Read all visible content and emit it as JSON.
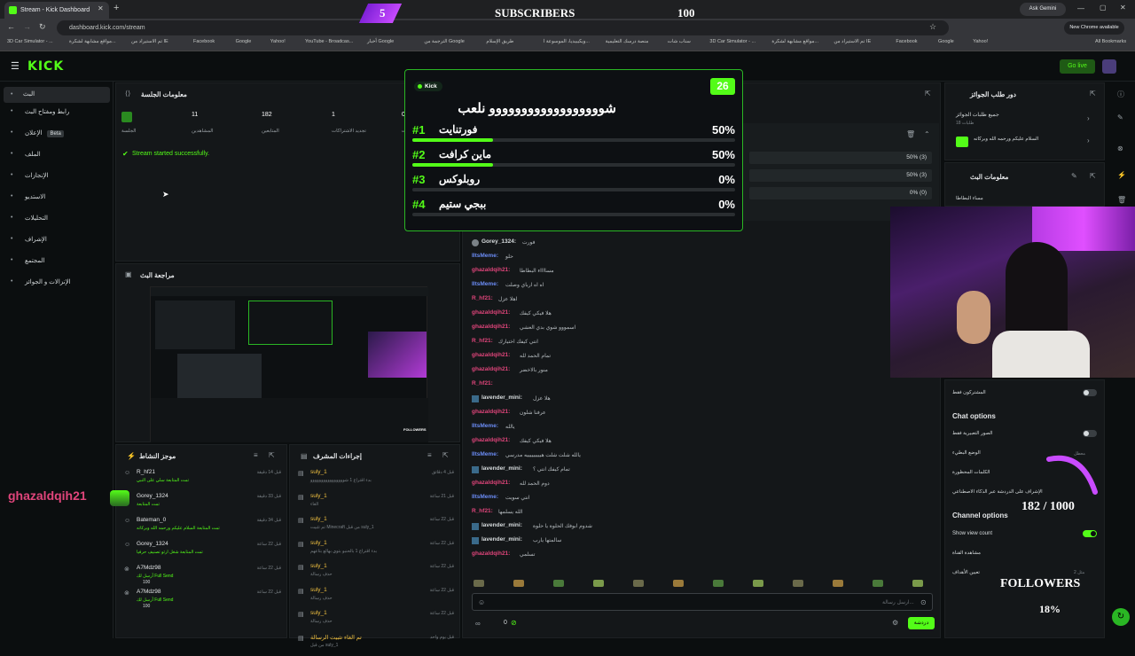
{
  "browser": {
    "tab_title": "Stream - Kick Dashboard",
    "url": "dashboard.kick.com/stream",
    "ask_gemini": "Ask Gemini",
    "new_chrome": "New Chrome available",
    "all_bookmarks": "All Bookmarks",
    "bookmarks": [
      "3D Car Simulator - ...",
      "مواقع مشابهة لشكرة...",
      "تم الاستيراد من IE",
      "Facebook",
      "Google",
      "Yahoo!",
      "YouTube - Broadcas...",
      "أخبار Google",
      "الترجمة من Google",
      "طريق الإسلام",
      "ويكيبيديا، الموسوعة ا...",
      "منصة درسك التعليمية",
      "سناب شات",
      "3D Car Simulator - ...",
      "مواقع مشابهة لشكرة...",
      "تم الاستيراد من IE",
      "Facebook",
      "Google",
      "Yahoo!"
    ]
  },
  "overlay": {
    "sub_count": "5",
    "subscribers_label": "SUBSCRIBERS",
    "sub_goal": "100",
    "followers_count": "182 / 1000",
    "followers_label": "FOLLOWERS",
    "followers_pct": "18%",
    "followers_progress": 0.18,
    "chat_highlight_name": "ghazaldqih21"
  },
  "topnav": {
    "logo": "KICK",
    "go_live": "Go live"
  },
  "sidebar": {
    "items": [
      {
        "label": "البث"
      },
      {
        "label": "رابط ومفتاح البث"
      },
      {
        "label": "الإعلان",
        "badge": "Beta"
      },
      {
        "label": "الملف"
      },
      {
        "label": "الإنجازات"
      },
      {
        "label": "الاستديو"
      },
      {
        "label": "التحليلات"
      },
      {
        "label": "الإشراف"
      },
      {
        "label": "المجتمع"
      },
      {
        "label": "الإنزالات و الجوائز"
      }
    ]
  },
  "session": {
    "title": "معلومات الجلسة",
    "stats": [
      {
        "value": "",
        "label": "الجلسة"
      },
      {
        "value": "11",
        "label": "المشاهدين"
      },
      {
        "value": "182",
        "label": "المتابعين"
      },
      {
        "value": "1",
        "label": "تجديد الاشتراكات"
      },
      {
        "value": "0",
        "label": "تبرعات"
      }
    ],
    "status": "Stream started successfully."
  },
  "preview": {
    "title": "مراجعة البث"
  },
  "poll": {
    "source": "Kick",
    "timer": "26",
    "question": "شوووووووووووووووووو نلعب",
    "options": [
      {
        "num": "#1",
        "label": "فورتنايت",
        "pct": "50%",
        "value": 0.5
      },
      {
        "num": "#2",
        "label": "ماين كرافت",
        "pct": "50%",
        "value": 0.5
      },
      {
        "num": "#3",
        "label": "روبلوكس",
        "pct": "0%",
        "value": 0
      },
      {
        "num": "#4",
        "label": "ببجي ستيم",
        "pct": "0%",
        "value": 0
      }
    ],
    "dash_pcts": [
      "50% (3)",
      "50% (3)",
      "0% (0)"
    ]
  },
  "chat": {
    "lines": [
      {
        "name": "Gorey_1324",
        "msg": "فورت",
        "color": "white"
      },
      {
        "name": "IltsMeme",
        "msg": "حلو",
        "color": "blue"
      },
      {
        "name": "ghazaldqih21",
        "msg": "مسااااء البطاطا",
        "color": "pink"
      },
      {
        "name": "IltsMeme",
        "msg": "اه اه ارباي وصلت",
        "color": "blue"
      },
      {
        "name": "R_hf21",
        "msg": "اهلا عزل",
        "color": "pink"
      },
      {
        "name": "ghazaldqih21",
        "msg": "هلا فيكي كيفك",
        "color": "pink"
      },
      {
        "name": "ghazaldqih21",
        "msg": "اسمووو شوي بدي العشي",
        "color": "pink"
      },
      {
        "name": "R_hf21",
        "msg": "انتي كيفك اختيارك",
        "color": "pink"
      },
      {
        "name": "ghazaldqih21",
        "msg": "تمام الحمد لله",
        "color": "pink"
      },
      {
        "name": "ghazaldqih21",
        "msg": "منور بالاخضر",
        "color": "pink"
      },
      {
        "name": "R_hf21",
        "msg": "",
        "color": "pink"
      },
      {
        "name": "lavender_mini",
        "msg": "هلا عزل",
        "color": "white"
      },
      {
        "name": "ghazaldqih21",
        "msg": "عرفنا شلون",
        "color": "pink"
      },
      {
        "name": "IltsMeme",
        "msg": "يالله",
        "color": "blue"
      },
      {
        "name": "ghazaldqih21",
        "msg": "هلا فيكي كيفك",
        "color": "pink"
      },
      {
        "name": "IltsMeme",
        "msg": "يالله شلت شلت هيييييييييه مدرسي",
        "color": "blue"
      },
      {
        "name": "lavender_mini",
        "msg": "تمام كيفك انتي ؟",
        "color": "white"
      },
      {
        "name": "ghazaldqih21",
        "msg": "دوم الحمد لله",
        "color": "pink"
      },
      {
        "name": "IltsMeme",
        "msg": "انتي سويت",
        "color": "blue"
      },
      {
        "name": "R_hf21",
        "msg": "الله يسلمها",
        "color": "pink"
      },
      {
        "name": "lavender_mini",
        "msg": "شدوم ابوفك الحلوة يا حلوة",
        "color": "white"
      },
      {
        "name": "lavender_mini",
        "msg": "سالمتها يارب",
        "color": "white"
      },
      {
        "name": "ghazaldqih21",
        "msg": "تسلمي",
        "color": "pink"
      }
    ],
    "input_placeholder": "ارسل رسالة...",
    "send_label": "دردشة",
    "viewer_count": "0"
  },
  "activity": {
    "title": "موجز النشاط",
    "items": [
      {
        "name": "R_hf21",
        "desc": "تمت المتابعة سلي على النبي",
        "time": "قبل 14 دقيقة"
      },
      {
        "name": "Gorey_1324",
        "desc": "تمت المتابعة",
        "time": "قبل 33 دقيقة"
      },
      {
        "name": "Bateman_0",
        "desc": "تمت المتابعة السلام عليكم ورحمه الله وبركاته",
        "time": "قبل 34 دقيقة"
      },
      {
        "name": "Gorey_1324",
        "desc": "تمت المتابعة شغل ارثو تصنيف حرفيا",
        "time": "قبل 22 ساعة"
      },
      {
        "name": "A7Mdz98",
        "desc": "أرسل لك Full Send",
        "extra": "100",
        "time": "قبل 22 ساعة"
      },
      {
        "name": "A7Mdz98",
        "desc": "أرسل لك Full Send",
        "extra": "100",
        "time": "قبل 22 ساعة"
      }
    ]
  },
  "modactions": {
    "title": "إجراءات المشرف",
    "items": [
      {
        "name": "suly_1",
        "desc": "بدء اقتراع 1 شوووووووووووووووو",
        "time": "قبل 4 دقائق"
      },
      {
        "name": "suly_1",
        "desc": "الغاء",
        "time": "قبل 21 ساعة"
      },
      {
        "name": "suly_1",
        "desc": "تم تثبيت Minecraft من قبل suly_1",
        "time": "قبل 22 ساعة"
      },
      {
        "name": "suly_1",
        "desc": "بدء اقتراع 1 بالحنبو بتوي بهالع بتاعهم",
        "time": "قبل 22 ساعة"
      },
      {
        "name": "suly_1",
        "desc": "حذف رسالة",
        "time": "قبل 22 ساعة"
      },
      {
        "name": "suly_1",
        "desc": "حذف رسالة",
        "time": "قبل 22 ساعة"
      },
      {
        "name": "suly_1",
        "desc": "حذف رسالة",
        "time": "قبل 22 ساعة"
      },
      {
        "name": "تم الغاء تثبيت الرسالة",
        "desc": "من قبل suly_1",
        "time": "قبل يوم واحد"
      }
    ]
  },
  "rewards": {
    "title": "دور طلب الجوائز",
    "all_requests": "جميع طلبات الجوائز",
    "count": "18 طلبات",
    "reward_item": "السلام عليكم ورحمه الله وبركاته"
  },
  "streaminfo": {
    "title": "معلومات البث",
    "name": "مساء البطاطا"
  },
  "settings": {
    "subs_only": "المشتركون فقط",
    "chat_options": "Chat options",
    "emotes_only": "الصور التعبيرية فقط",
    "slow_mode": "الوضع البطيء",
    "slow_value": "معطل",
    "banned_words": "الكلمات المحظورة",
    "ai_mod": "الإشراف على الدردشة عبر الذكاء الاصطناعي",
    "channel_options": "Channel options",
    "show_view_count": "Show view count",
    "chat_feedback": "مشاهدة القناة",
    "goals": "تعيين الأهداف",
    "goals_value": "مثل 2"
  }
}
